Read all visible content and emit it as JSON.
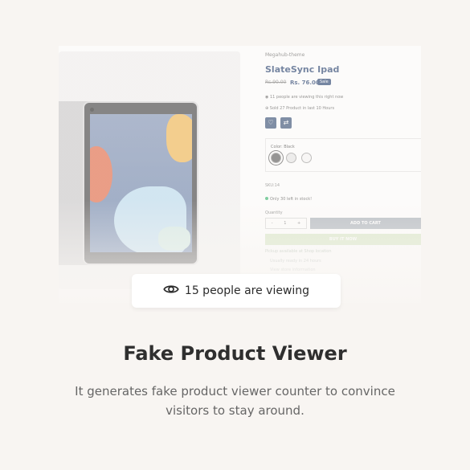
{
  "product": {
    "brand": "Megahub-theme",
    "title": "SlateSync Ipad",
    "price_old": "Rs.90.00",
    "price_new": "Rs. 76.00",
    "sale_badge": "Sale",
    "viewing_text": "11 people are viewing this right now",
    "sold_text": "Sold 27 Product in last 10 Hours",
    "wishlist_icon": "heart-icon",
    "compare_icon": "compare-icon",
    "color_label": "Color: Black",
    "swatches": [
      "Black",
      "Silver",
      "White"
    ],
    "sku": "SKU:14",
    "stock": "Only 30 left in stock!",
    "quantity_label": "Quantity",
    "quantity_minus": "-",
    "quantity_value": "1",
    "quantity_plus": "+",
    "add_to_cart": "ADD TO CART",
    "buy_now": "BUY IT NOW",
    "faint_1": "Pickup available at Shop location",
    "faint_2": "Usually ready in 24 hours",
    "faint_3": "View store information"
  },
  "pill": {
    "icon": "eye-icon",
    "text": "15 people are viewing"
  },
  "feature": {
    "title": "Fake Product Viewer",
    "description": "It generates fake product viewer counter to convince visitors to stay around."
  },
  "colors": {
    "background": "#f8f5f2",
    "navy": "#1e3a6b",
    "buy_green": "#cfe2ba"
  }
}
